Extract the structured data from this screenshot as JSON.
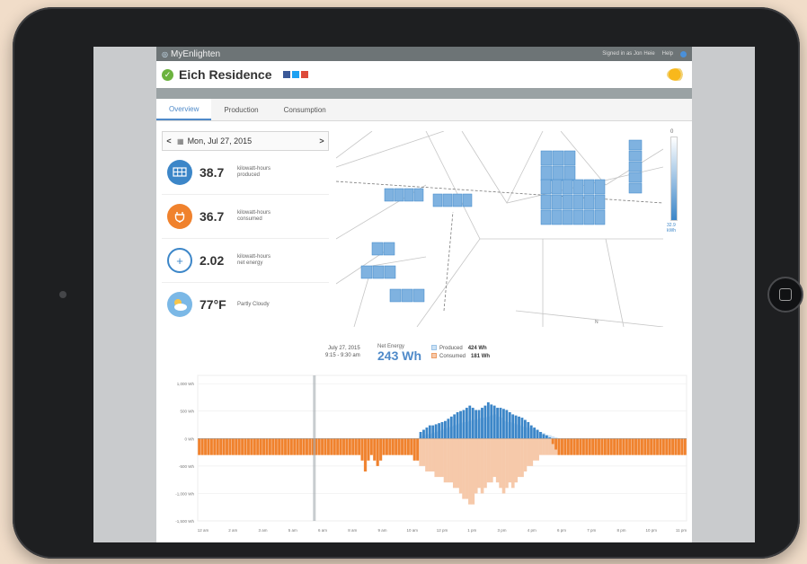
{
  "app": {
    "brand": "MyEnlighten",
    "signed_in": "Signed in as Jon Heie",
    "help": "Help"
  },
  "site": {
    "name": "Eich Residence"
  },
  "tabs": [
    {
      "label": "Overview"
    },
    {
      "label": "Production"
    },
    {
      "label": "Consumption"
    }
  ],
  "date_nav": {
    "prev": "<",
    "date": "Mon, Jul 27, 2015",
    "next": ">"
  },
  "stats": [
    {
      "value": "38.7",
      "label_line1": "kilowatt-hours",
      "label_line2": "produced"
    },
    {
      "value": "36.7",
      "label_line1": "kilowatt-hours",
      "label_line2": "consumed"
    },
    {
      "value": "2.02",
      "label_line1": "kilowatt-hours",
      "label_line2": "net energy"
    },
    {
      "value": "77°F",
      "label_line1": "Partly Cloudy",
      "label_line2": ""
    }
  ],
  "map_legend": {
    "top": "0",
    "bottom_value": "32.9",
    "bottom_unit": "kWh"
  },
  "summary": {
    "date": "July 27, 2015",
    "time": "9:15 - 9:30 am",
    "net_label": "Net Energy",
    "net_value": "243 Wh",
    "produced_label": "Produced",
    "produced_value": "424 Wh",
    "consumed_label": "Consumed",
    "consumed_value": "181 Wh"
  },
  "colors": {
    "produced": "#3c86c8",
    "produced_light": "#cbe1f4",
    "consumed": "#f0822d",
    "consumed_light": "#f6c9aa",
    "accent": "#4f8ac9"
  },
  "icons": {
    "solar": "solar-panel-icon",
    "consumption": "plug-icon",
    "net": "plus-icon",
    "weather": "partly-cloudy-icon",
    "calendar": "calendar-icon",
    "status": "check-icon"
  },
  "chart_data": {
    "type": "bar",
    "y_tick_labels": [
      "1,000 Wh",
      "500 Wh",
      "0 Wh",
      "-500 Wh",
      "-1,000 Wh",
      "-1,500 Wh"
    ],
    "y_ticks": [
      1000,
      500,
      0,
      -500,
      -1000,
      -1500
    ],
    "ylim": [
      -1500,
      1150
    ],
    "x_tick_labels": [
      "12 am",
      "2 am",
      "3 am",
      "5 am",
      "6 am",
      "8 am",
      "9 am",
      "10 am",
      "12 pm",
      "1 pm",
      "3 pm",
      "4 pm",
      "6 pm",
      "7 pm",
      "8 pm",
      "10 pm",
      "11 pm"
    ],
    "highlight_interval": "9:15 - 9:30 am",
    "series": [
      {
        "name": "Produced",
        "values": [
          0,
          0,
          0,
          0,
          0,
          0,
          0,
          0,
          0,
          0,
          0,
          0,
          0,
          0,
          0,
          0,
          0,
          0,
          0,
          0,
          0,
          0,
          0,
          0,
          0,
          0,
          0,
          0,
          0,
          0,
          0,
          0,
          0,
          0,
          0,
          0,
          0,
          0,
          0,
          0,
          0,
          0,
          0,
          0,
          0,
          0,
          0,
          0,
          0,
          0,
          0,
          0,
          0,
          0,
          0,
          0,
          0,
          0,
          0,
          0,
          0,
          0,
          0,
          0,
          0,
          0,
          0,
          0,
          0,
          0,
          0,
          0,
          40,
          60,
          80,
          80,
          100,
          120,
          140,
          160,
          180,
          200,
          220,
          240,
          260,
          280,
          300,
          300,
          320,
          340,
          340,
          360,
          380,
          380,
          400,
          420,
          440,
          400,
          380,
          320,
          300,
          300,
          280,
          260,
          240,
          220,
          200,
          200,
          180,
          160,
          140,
          120,
          100,
          60,
          60,
          40,
          20,
          0,
          0,
          0,
          0,
          0,
          0,
          0,
          0,
          0,
          0,
          0,
          0,
          0,
          0,
          0,
          0,
          0,
          0,
          0,
          0,
          0,
          0,
          0,
          0,
          0,
          0,
          0,
          0,
          0,
          0,
          0,
          0,
          0,
          0,
          0,
          0,
          0,
          0,
          0,
          0,
          0,
          0
        ]
      },
      {
        "name": "Consumed",
        "values": [
          -300,
          -300,
          -300,
          -300,
          -300,
          -300,
          -300,
          -300,
          -300,
          -300,
          -300,
          -300,
          -300,
          -300,
          -300,
          -300,
          -300,
          -300,
          -300,
          -300,
          -300,
          -300,
          -300,
          -300,
          -300,
          -300,
          -300,
          -300,
          -300,
          -300,
          -300,
          -300,
          -300,
          -300,
          -300,
          -300,
          -300,
          -300,
          -300,
          -300,
          -300,
          -300,
          -300,
          -300,
          -300,
          -300,
          -300,
          -300,
          -300,
          -300,
          -300,
          -300,
          -300,
          -400,
          -600,
          -400,
          -300,
          -400,
          -500,
          -400,
          -300,
          -300,
          -300,
          -300,
          -300,
          -300,
          -300,
          -300,
          -300,
          -300,
          -400,
          -400,
          -500,
          -500,
          -600,
          -600,
          -600,
          -700,
          -700,
          -700,
          -800,
          -800,
          -800,
          -900,
          -900,
          -1000,
          -1100,
          -1100,
          -1200,
          -1200,
          -1000,
          -900,
          -1000,
          -900,
          -800,
          -800,
          -700,
          -800,
          -900,
          -1000,
          -900,
          -800,
          -900,
          -800,
          -700,
          -700,
          -600,
          -500,
          -500,
          -400,
          -400,
          -300,
          -300,
          -300,
          -300,
          -300,
          -300,
          -300,
          -300,
          -300,
          -300,
          -300,
          -300,
          -300,
          -300,
          -300,
          -300,
          -300,
          -300,
          -300,
          -300,
          -300,
          -300,
          -300,
          -300,
          -300,
          -300,
          -300,
          -300,
          -300,
          -300,
          -300,
          -300,
          -300,
          -300,
          -300,
          -300,
          -300,
          -300,
          -300,
          -300,
          -300,
          -300,
          -300,
          -300,
          -300,
          -300,
          -300,
          -300,
          -300
        ]
      },
      {
        "name": "Net",
        "values": [
          -300,
          -300,
          -300,
          -300,
          -300,
          -300,
          -300,
          -300,
          -300,
          -300,
          -300,
          -300,
          -300,
          -300,
          -300,
          -300,
          -300,
          -300,
          -300,
          -300,
          -300,
          -300,
          -300,
          -300,
          -300,
          -300,
          -300,
          -300,
          -300,
          -300,
          -300,
          -300,
          -300,
          -300,
          -300,
          -300,
          -300,
          -300,
          -300,
          -300,
          -300,
          -300,
          -300,
          -300,
          -300,
          -300,
          -300,
          -300,
          -300,
          -300,
          -300,
          -300,
          -300,
          -400,
          -600,
          -400,
          -300,
          -400,
          -500,
          -400,
          -300,
          -300,
          -300,
          -300,
          -300,
          -300,
          -300,
          -300,
          -300,
          -300,
          -400,
          -400,
          120,
          160,
          200,
          240,
          240,
          260,
          280,
          300,
          320,
          360,
          400,
          440,
          480,
          500,
          520,
          560,
          600,
          560,
          520,
          520,
          560,
          600,
          660,
          620,
          600,
          560,
          560,
          540,
          520,
          480,
          440,
          420,
          400,
          380,
          340,
          300,
          240,
          200,
          160,
          120,
          80,
          60,
          20,
          -100,
          -200,
          -300,
          -300,
          -300,
          -300,
          -300,
          -300,
          -300,
          -300,
          -300,
          -300,
          -300,
          -300,
          -300,
          -300,
          -300,
          -300,
          -300,
          -300,
          -300,
          -300,
          -300,
          -300,
          -300,
          -300,
          -300,
          -300,
          -300,
          -300,
          -300,
          -300,
          -300,
          -300,
          -300,
          -300,
          -300,
          -300,
          -300,
          -300,
          -300,
          -300,
          -300,
          -300,
          -300,
          -300,
          -300,
          -300,
          -300
        ]
      }
    ]
  }
}
